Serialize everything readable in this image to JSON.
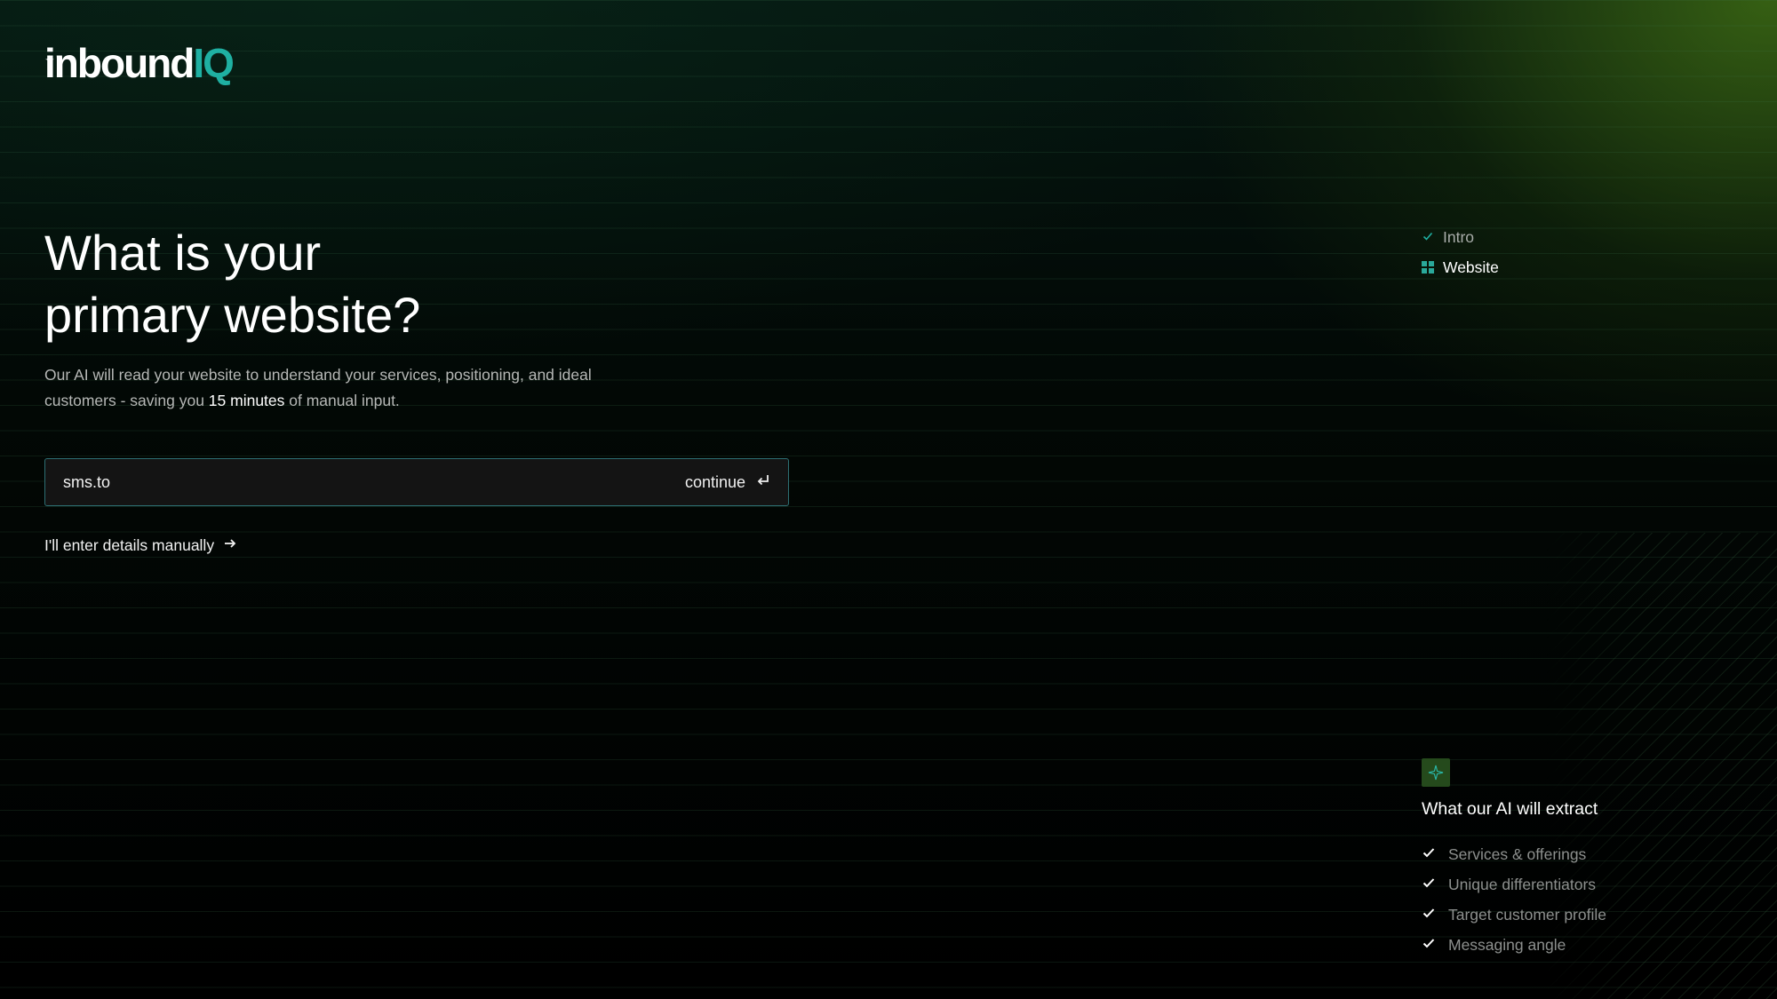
{
  "brand": {
    "logo_prefix": "inbound",
    "logo_suffix": "IQ",
    "accent_color": "#1fb0a2",
    "highlight_color": "#4c8a1e"
  },
  "main": {
    "headline_line1": "What is your",
    "headline_line2": "primary website?",
    "subtext_before": "Our AI will read your website to understand your services, positioning, and ideal customers - saving you ",
    "subtext_highlight": "15 minutes",
    "subtext_after": " of manual input.",
    "url_input": {
      "value": "sms.to",
      "placeholder": ""
    },
    "continue_label": "continue",
    "manual_label": "I'll enter details manually"
  },
  "steps": [
    {
      "label": "Intro",
      "state": "done",
      "icon": "check-icon"
    },
    {
      "label": "Website",
      "state": "active",
      "icon": "grid-icon"
    }
  ],
  "extract": {
    "icon": "sparkle-icon",
    "title": "What our AI will extract",
    "items": [
      "Services & offerings",
      "Unique differentiators",
      "Target customer profile",
      "Messaging angle"
    ]
  }
}
